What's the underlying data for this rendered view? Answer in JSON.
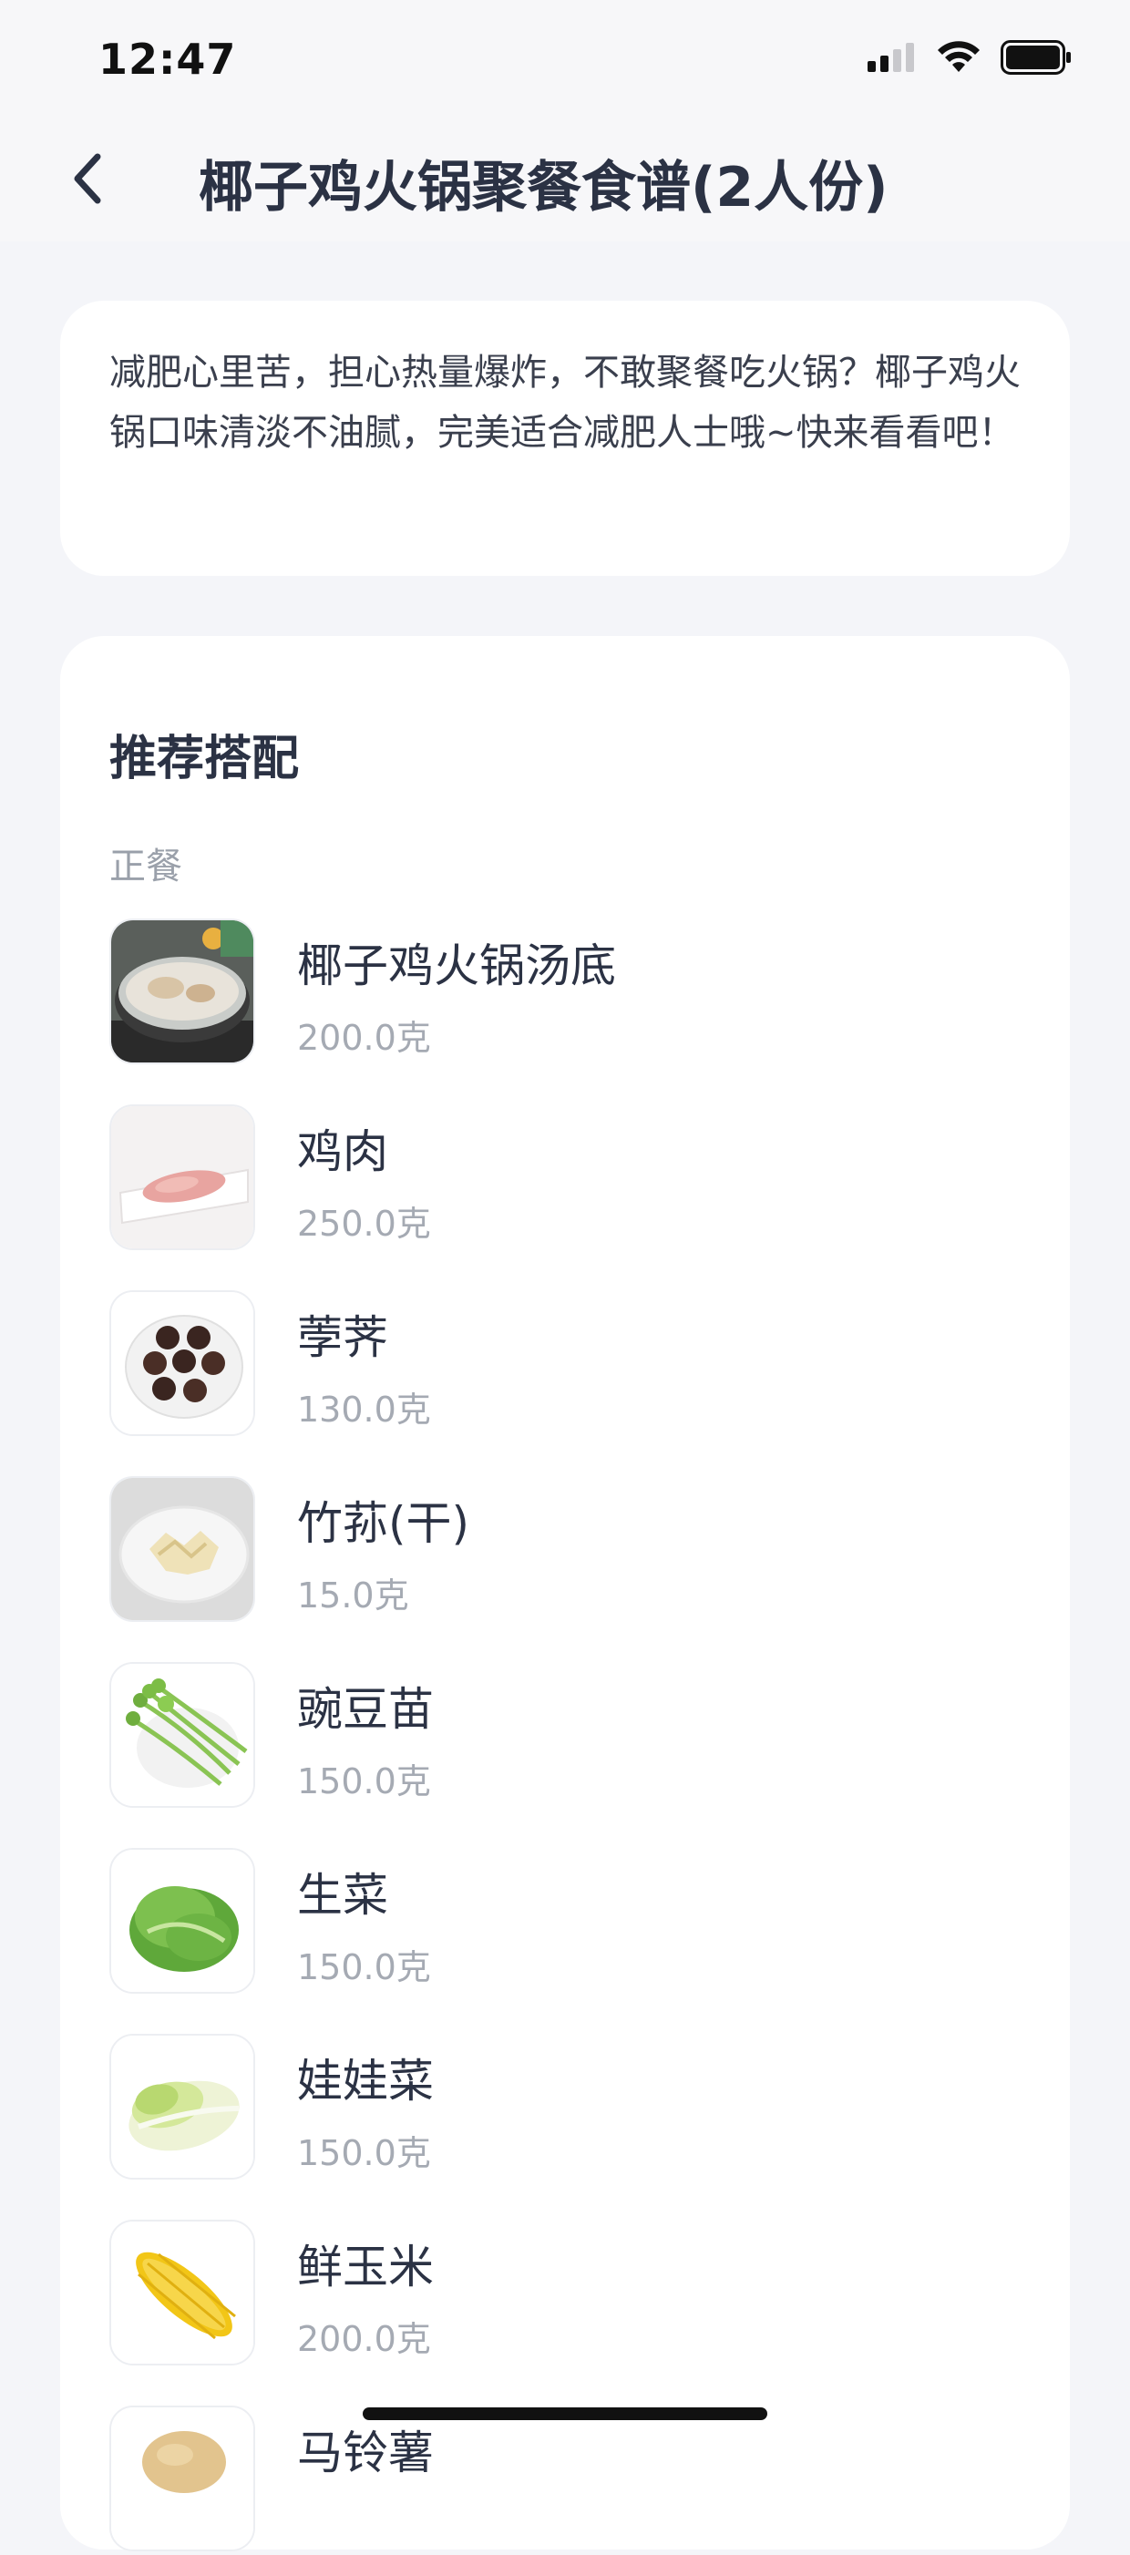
{
  "status_bar": {
    "time": "12:47"
  },
  "header": {
    "title": "椰子鸡火锅聚餐食谱(2人份)"
  },
  "intro": {
    "text": "减肥心里苦，担心热量爆炸，不敢聚餐吃火锅？椰子鸡火锅口味清淡不油腻，完美适合减肥人士哦~快来看看吧！"
  },
  "recommend": {
    "title": "推荐搭配",
    "category": "正餐",
    "items": [
      {
        "name": "椰子鸡火锅汤底",
        "amount": "200.0克",
        "image": "hotpot-soup-image"
      },
      {
        "name": "鸡肉",
        "amount": "250.0克",
        "image": "chicken-image"
      },
      {
        "name": "荸荠",
        "amount": "130.0克",
        "image": "water-chestnut-image"
      },
      {
        "name": "竹荪(干)",
        "amount": "15.0克",
        "image": "bamboo-fungus-image"
      },
      {
        "name": "豌豆苗",
        "amount": "150.0克",
        "image": "pea-shoots-image"
      },
      {
        "name": "生菜",
        "amount": "150.0克",
        "image": "lettuce-image"
      },
      {
        "name": "娃娃菜",
        "amount": "150.0克",
        "image": "baby-cabbage-image"
      },
      {
        "name": "鲜玉米",
        "amount": "200.0克",
        "image": "corn-image"
      },
      {
        "name": "马铃薯",
        "amount": "",
        "image": "potato-image"
      }
    ]
  }
}
